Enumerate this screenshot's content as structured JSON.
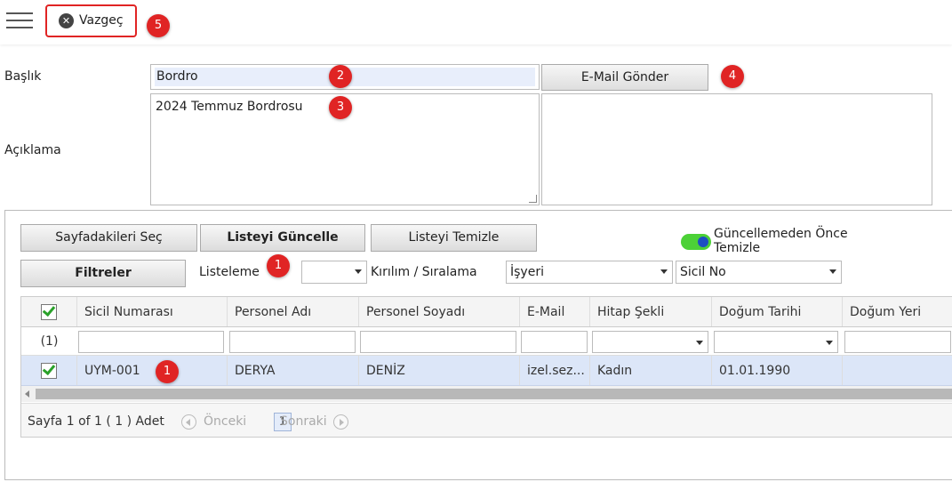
{
  "topbar": {
    "cancel_label": "Vazgeç"
  },
  "badges": {
    "b1": "1",
    "b2": "2",
    "b3": "3",
    "b4": "4",
    "b5": "5",
    "b6": "1"
  },
  "form": {
    "title_label": "Başlık",
    "title_value": "Bordro",
    "email_button": "E-Mail Gönder",
    "desc_label": "Açıklama",
    "desc_value": "2024 Temmuz Bordrosu"
  },
  "toolbar": {
    "select_page": "Sayfadakileri Seç",
    "refresh_list": "Listeyi Güncelle",
    "clear_list": "Listeyi Temizle",
    "toggle_label": "Güncellemeden Önce Temizle",
    "toggle_on": true,
    "filters": "Filtreler",
    "listing_label": "Listeleme",
    "listing_value": "",
    "breakdown_label": "Kırılım / Sıralama",
    "breakdown_value": "İşyeri",
    "sort_value": "Sicil No"
  },
  "grid": {
    "columns": [
      "Sicil Numarası",
      "Personel Adı",
      "Personel Soyadı",
      "E-Mail",
      "Hitap Şekli",
      "Doğum Tarihi",
      "Doğum Yeri"
    ],
    "count_label": "(1)",
    "rows": [
      {
        "checked": true,
        "cells": [
          "UYM-001",
          "DERYA",
          "DENİZ",
          "izel.sez...",
          "Kadın",
          "01.01.1990",
          ""
        ]
      }
    ]
  },
  "pager": {
    "summary": "Sayfa 1 of 1 ( 1 ) Adet",
    "prev": "Önceki",
    "page": "1",
    "next": "Sonraki"
  },
  "colors": {
    "accent_red": "#e02424",
    "toggle_green": "#4cd137",
    "row_selected": "#dce6f8"
  }
}
